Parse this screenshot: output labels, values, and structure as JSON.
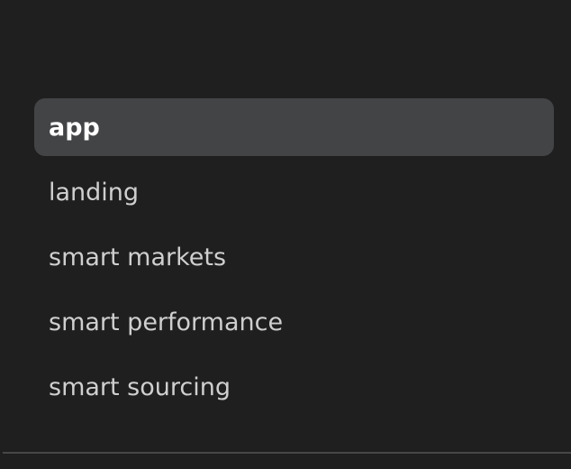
{
  "menu": {
    "items": [
      {
        "label": "app",
        "active": true
      },
      {
        "label": "landing",
        "active": false
      },
      {
        "label": "smart markets",
        "active": false
      },
      {
        "label": "smart performance",
        "active": false
      },
      {
        "label": "smart sourcing",
        "active": false
      }
    ]
  },
  "colors": {
    "background": "#1f1f1f",
    "active_item_bg": "#434446",
    "text": "#cfcfcf",
    "active_text": "#ffffff",
    "divider": "#474747"
  }
}
